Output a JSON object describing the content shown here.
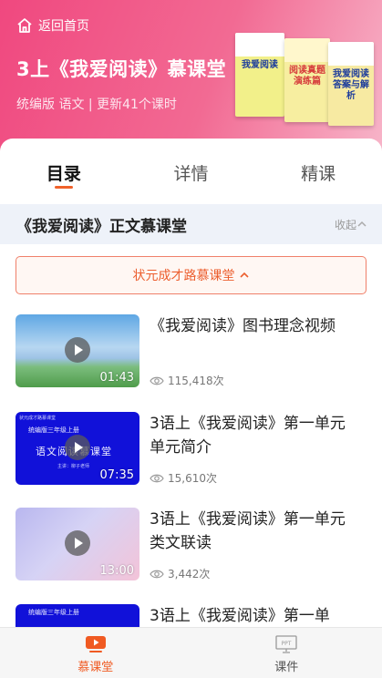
{
  "header": {
    "back_label": "返回首页",
    "title": "3上《我爱阅读》慕课堂",
    "meta": "统编版 语文 | 更新41个课时",
    "books": [
      {
        "label": "我爱阅读"
      },
      {
        "label": "阅读真题 演练篇"
      },
      {
        "label": "我爱阅读 答案与解析"
      }
    ]
  },
  "tabs": [
    {
      "label": "目录",
      "active": true
    },
    {
      "label": "详情",
      "active": false
    },
    {
      "label": "精课",
      "active": false
    }
  ],
  "section": {
    "title": "《我爱阅读》正文慕课堂",
    "collapse_label": "收起"
  },
  "pill": {
    "label": "状元成才路慕课堂"
  },
  "videos": [
    {
      "title": "《我爱阅读》图书理念视频",
      "duration": "01:43",
      "views": "115,418次"
    },
    {
      "title": "3语上《我爱阅读》第一单元 单元简介",
      "duration": "07:35",
      "views": "15,610次",
      "thumb_text": {
        "top": "状元成才路慕课堂",
        "line": "统编版三年级上册",
        "big": "语文阅读慕课堂",
        "sub": "主讲：柳子老师"
      }
    },
    {
      "title": "3语上《我爱阅读》第一单元 类文联读",
      "duration": "13:00",
      "views": "3,442次"
    },
    {
      "title": "3语上《我爱阅读》第一单",
      "duration": "",
      "views": "",
      "thumb_text": {
        "line": "统编版三年级上册"
      }
    }
  ],
  "bottom_nav": [
    {
      "label": "慕课堂",
      "active": true,
      "icon": "play-icon"
    },
    {
      "label": "课件",
      "active": false,
      "icon": "ppt-icon"
    }
  ],
  "colors": {
    "accent": "#f05a22",
    "header_pink": "#f0487f",
    "section_bg": "#eef2f9"
  }
}
